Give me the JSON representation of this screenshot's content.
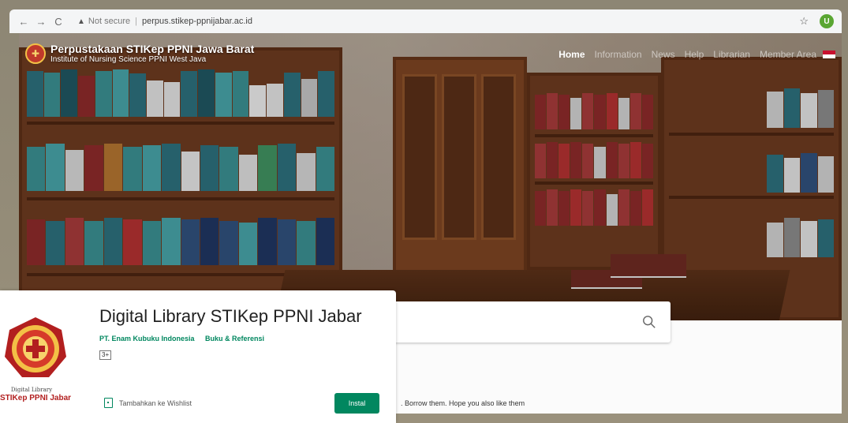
{
  "browser": {
    "back": "←",
    "forward": "→",
    "reload": "C",
    "security_label": "Not secure",
    "url": "perpus.stikep-ppnijabar.ac.id",
    "star": "☆",
    "profile_initial": "U"
  },
  "site": {
    "title": "Perpustakaan STIKep PPNI Jawa Barat",
    "subtitle": "Institute of Nursing Science PPNI West Java",
    "nav": [
      "Home",
      "Information",
      "News",
      "Help",
      "Librarian",
      "Member Area"
    ],
    "tagline": ". Borrow them. Hope you also like them"
  },
  "app_card": {
    "title": "Digital Library STIKep PPNI Jabar",
    "developer": "PT. Enam Kubuku Indonesia",
    "category": "Buku & Referensi",
    "rating": "3+",
    "wishlist_label": "Tambahkan ke Wishlist",
    "install_label": "Instal",
    "logo_caption_1": "Digital Library",
    "logo_caption_2": "STIKep PPNI Jabar"
  },
  "colors": {
    "play_green": "#01875f",
    "logo_red": "#b21f1f",
    "seal_gold": "#f3c046"
  },
  "icons": {
    "search": "search-icon",
    "bookmark": "bookmark-icon",
    "profile": "profile-icon",
    "flag": "flag-icon"
  }
}
